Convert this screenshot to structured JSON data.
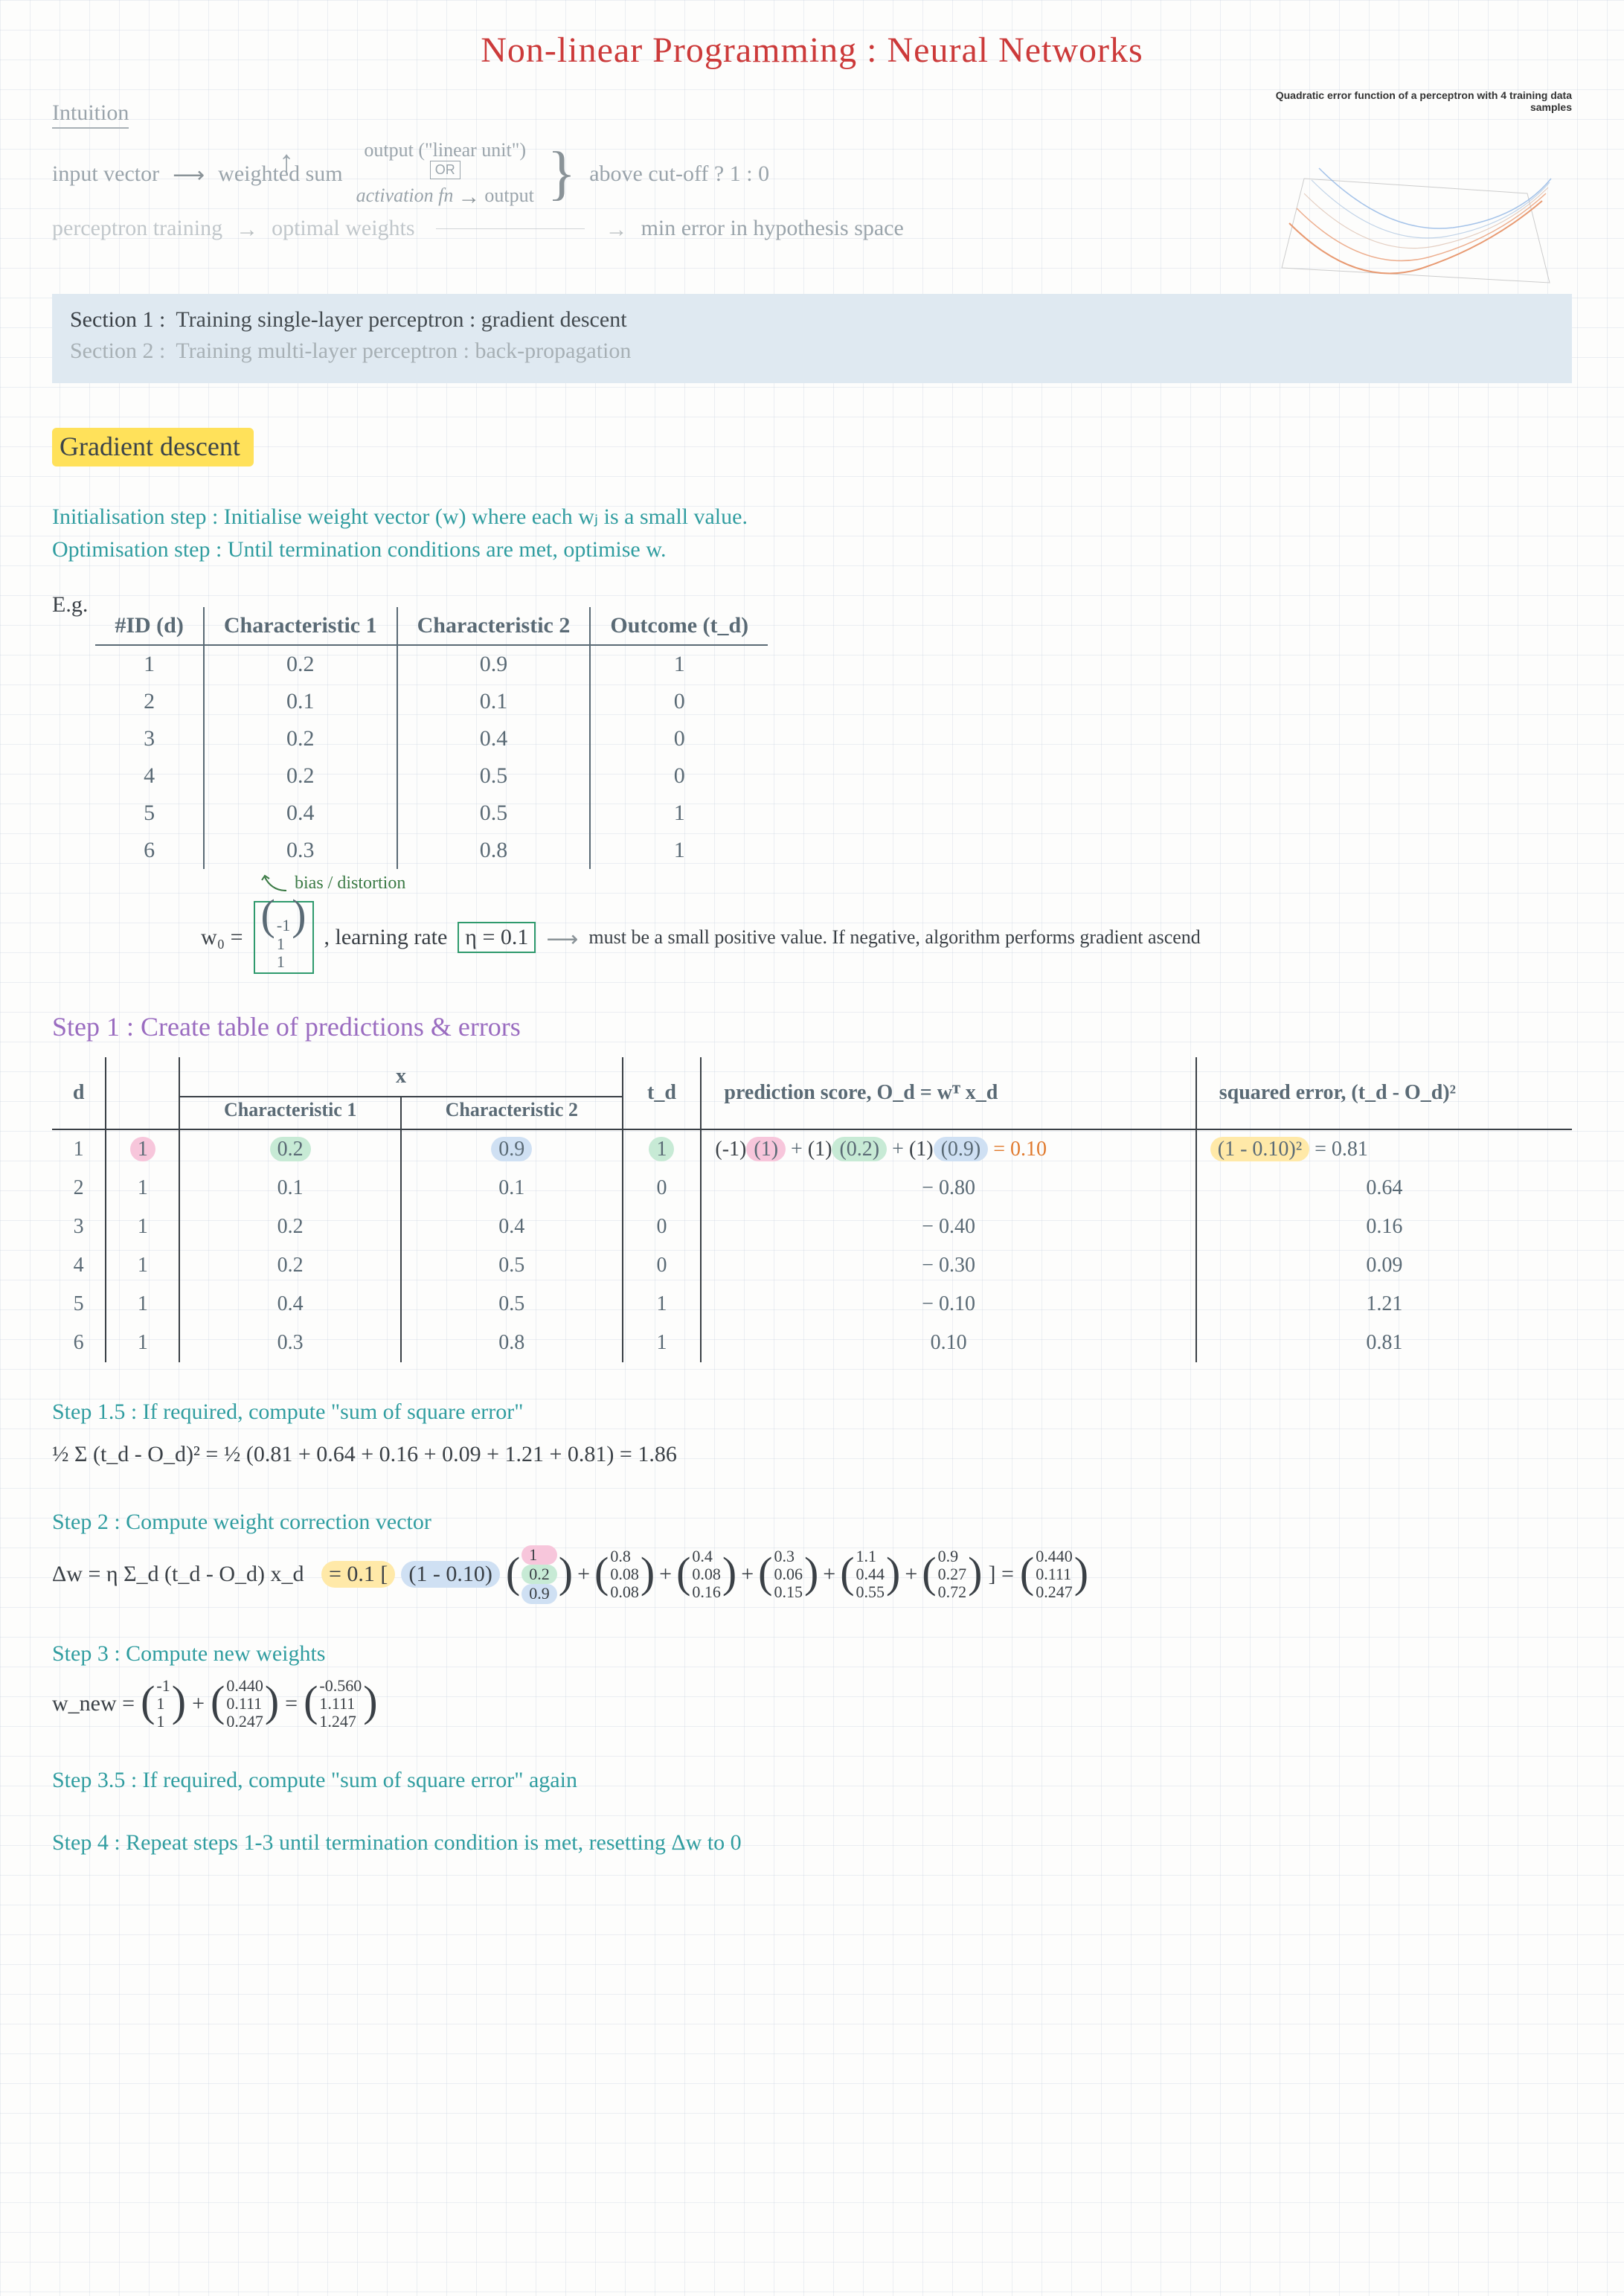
{
  "title": "Non-linear Programming : Neural Networks",
  "surface_caption": "Quadratic error function of a perceptron with 4 training data samples",
  "intuition": {
    "heading": "Intuition",
    "input_vector": "input vector",
    "weighted_sum": "weighted sum",
    "output_linear": "output (\"linear unit\")",
    "or": "OR",
    "activation": "activation fn",
    "output": "output",
    "cutoff": "above cut-off ? 1 : 0",
    "perceptron_training": "perceptron training",
    "optimal_weights": "optimal weights",
    "min_error": "min error in hypothesis space"
  },
  "sections": {
    "s1_label": "Section 1 :",
    "s1_text": "Training single-layer perceptron : gradient descent",
    "s2_label": "Section 2 :",
    "s2_text": "Training multi-layer perceptron : back-propagation"
  },
  "gd_heading": "Gradient descent",
  "init_step": "Initialisation step : Initialise weight vector (w) where each wⱼ is a small value.",
  "opt_step": "Optimisation step : Until termination conditions are met, optimise w.",
  "eg_label": "E.g.",
  "eg_headers": [
    "#ID (d)",
    "Characteristic 1",
    "Characteristic 2",
    "Outcome (t_d)"
  ],
  "eg_rows": [
    [
      "1",
      "0.2",
      "0.9",
      "1"
    ],
    [
      "2",
      "0.1",
      "0.1",
      "0"
    ],
    [
      "3",
      "0.2",
      "0.4",
      "0"
    ],
    [
      "4",
      "0.2",
      "0.5",
      "0"
    ],
    [
      "5",
      "0.4",
      "0.5",
      "1"
    ],
    [
      "6",
      "0.3",
      "0.8",
      "1"
    ]
  ],
  "bias_note": "bias / distortion",
  "w0_label": "w₀ =",
  "w0_vec": [
    "-1",
    "1",
    "1"
  ],
  "learning_rate_label": ", learning rate",
  "eta": "η = 0.1",
  "eta_note": "must be a small positive value. If negative, algorithm performs gradient ascend",
  "step1": "Step 1 : Create table of predictions & errors",
  "pred_headers": {
    "d": "d",
    "x": "x",
    "c1": "Characteristic 1",
    "c2": "Characteristic 2",
    "td": "t_d",
    "pred": "prediction score, O_d = wᵀ x_d",
    "sqerr": "squared error, (t_d - O_d)²"
  },
  "pred_rows": [
    {
      "d": "1",
      "bias": "1",
      "c1": "0.2",
      "c2": "0.9",
      "td": "1",
      "pred": "(-1)(1) + (1)(0.2) + (1)(0.9) = 0.10",
      "sq": "(1 - 0.10)² = 0.81"
    },
    {
      "d": "2",
      "bias": "1",
      "c1": "0.1",
      "c2": "0.1",
      "td": "0",
      "pred": "− 0.80",
      "sq": "0.64"
    },
    {
      "d": "3",
      "bias": "1",
      "c1": "0.2",
      "c2": "0.4",
      "td": "0",
      "pred": "− 0.40",
      "sq": "0.16"
    },
    {
      "d": "4",
      "bias": "1",
      "c1": "0.2",
      "c2": "0.5",
      "td": "0",
      "pred": "− 0.30",
      "sq": "0.09"
    },
    {
      "d": "5",
      "bias": "1",
      "c1": "0.4",
      "c2": "0.5",
      "td": "1",
      "pred": "− 0.10",
      "sq": "1.21"
    },
    {
      "d": "6",
      "bias": "1",
      "c1": "0.3",
      "c2": "0.8",
      "td": "1",
      "pred": "0.10",
      "sq": "0.81"
    }
  ],
  "step15_label": "Step 1.5 :",
  "step15_text": "If required, compute \"sum of square error\"",
  "step15_eq": "½ Σ (t_d - O_d)² = ½ (0.81 + 0.64 + 0.16 + 0.09 + 1.21 + 0.81) = 1.86",
  "step2_label": "Step 2 :",
  "step2_text": "Compute weight correction vector",
  "step2_lhs": "Δw = η Σ_d (t_d - O_d) x_d",
  "step2_prefix": "= 0.1 [",
  "step2_term1_scalar": "(1 - 0.10)",
  "step2_vecs": [
    [
      "1",
      "0.2",
      "0.9"
    ],
    [
      "0.8",
      "0.08",
      "0.08"
    ],
    [
      "0.4",
      "0.08",
      "0.16"
    ],
    [
      "0.3",
      "0.06",
      "0.15"
    ],
    [
      "1.1",
      "0.44",
      "0.55"
    ],
    [
      "0.9",
      "0.27",
      "0.72"
    ]
  ],
  "step2_result": [
    "0.440",
    "0.111",
    "0.247"
  ],
  "step3_label": "Step 3 :",
  "step3_text": "Compute new weights",
  "step3_lhs": "w_new =",
  "step3_v1": [
    "-1",
    "1",
    "1"
  ],
  "step3_v2": [
    "0.440",
    "0.111",
    "0.247"
  ],
  "step3_res": [
    "-0.560",
    "1.111",
    "1.247"
  ],
  "step35_label": "Step 3.5 :",
  "step35_text": "If required, compute \"sum of square error\" again",
  "step4_label": "Step 4 :",
  "step4_text": "Repeat steps 1-3 until termination condition is met, resetting Δw to 0"
}
